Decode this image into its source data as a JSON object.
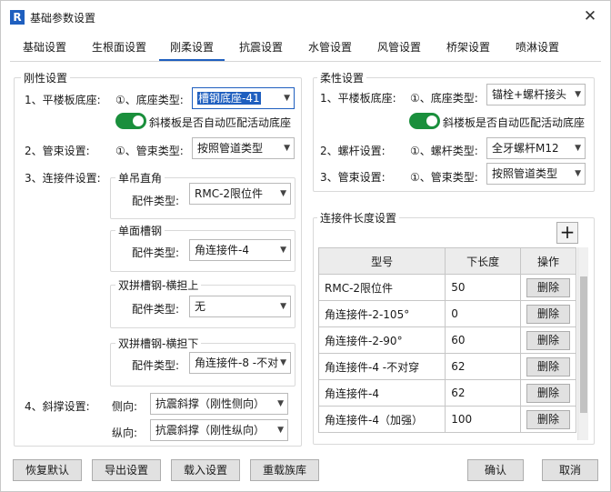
{
  "window": {
    "icon_letter": "R",
    "title": "基础参数设置",
    "close": "✕"
  },
  "tabs": [
    {
      "label": "基础设置",
      "active": false
    },
    {
      "label": "生根面设置",
      "active": false
    },
    {
      "label": "刚柔设置",
      "active": true
    },
    {
      "label": "抗震设置",
      "active": false
    },
    {
      "label": "水管设置",
      "active": false
    },
    {
      "label": "风管设置",
      "active": false
    },
    {
      "label": "桥架设置",
      "active": false
    },
    {
      "label": "喷淋设置",
      "active": false
    }
  ],
  "rigid": {
    "title": "刚性设置",
    "floor": {
      "label": "1、平楼板底座:",
      "sub": "①、底座类型:",
      "value": "槽钢底座-41"
    },
    "slope_toggle": {
      "on": true,
      "label": "斜楼板是否自动匹配活动底座"
    },
    "bundle": {
      "label": "2、管束设置:",
      "sub": "①、管束类型:",
      "value": "按照管道类型"
    },
    "connector": {
      "label": "3、连接件设置:",
      "groups": [
        {
          "title": "单吊直角",
          "field_label": "配件类型:",
          "value": "RMC-2限位件"
        },
        {
          "title": "单面槽钢",
          "field_label": "配件类型:",
          "value": "角连接件-4"
        },
        {
          "title": "双拼槽钢-横担上",
          "field_label": "配件类型:",
          "value": "无"
        },
        {
          "title": "双拼槽钢-横担下",
          "field_label": "配件类型:",
          "value": "角连接件-8 -不对"
        }
      ]
    },
    "brace": {
      "label": "4、斜撑设置:",
      "side_label": "侧向:",
      "side_value": "抗震斜撑（刚性侧向）",
      "long_label": "纵向:",
      "long_value": "抗震斜撑（刚性纵向）"
    }
  },
  "flex": {
    "title": "柔性设置",
    "floor": {
      "label": "1、平楼板底座:",
      "sub": "①、底座类型:",
      "value": "锚栓+螺杆接头"
    },
    "slope_toggle": {
      "on": true,
      "label": "斜楼板是否自动匹配活动底座"
    },
    "rod": {
      "label": "2、螺杆设置:",
      "sub": "①、螺杆类型:",
      "value": "全牙螺杆M12"
    },
    "bundle": {
      "label": "3、管束设置:",
      "sub": "①、管束类型:",
      "value": "按照管道类型"
    }
  },
  "length": {
    "title": "连接件长度设置",
    "add_symbol": "+",
    "headers": {
      "model": "型号",
      "length": "下长度",
      "action": "操作"
    },
    "delete_label": "删除",
    "rows": [
      {
        "model": "RMC-2限位件",
        "length": "50"
      },
      {
        "model": "角连接件-2-105°",
        "length": "0"
      },
      {
        "model": "角连接件-2-90°",
        "length": "60"
      },
      {
        "model": "角连接件-4 -不对穿",
        "length": "62"
      },
      {
        "model": "角连接件-4",
        "length": "62"
      },
      {
        "model": "角连接件-4（加强）",
        "length": "100"
      }
    ]
  },
  "footer": {
    "restore": "恢复默认",
    "export": "导出设置",
    "load": "载入设置",
    "reload_family": "重载族库",
    "ok": "确认",
    "cancel": "取消"
  },
  "colors": {
    "accent": "#1f5fbf",
    "toggle_on": "#1a8f3c"
  }
}
